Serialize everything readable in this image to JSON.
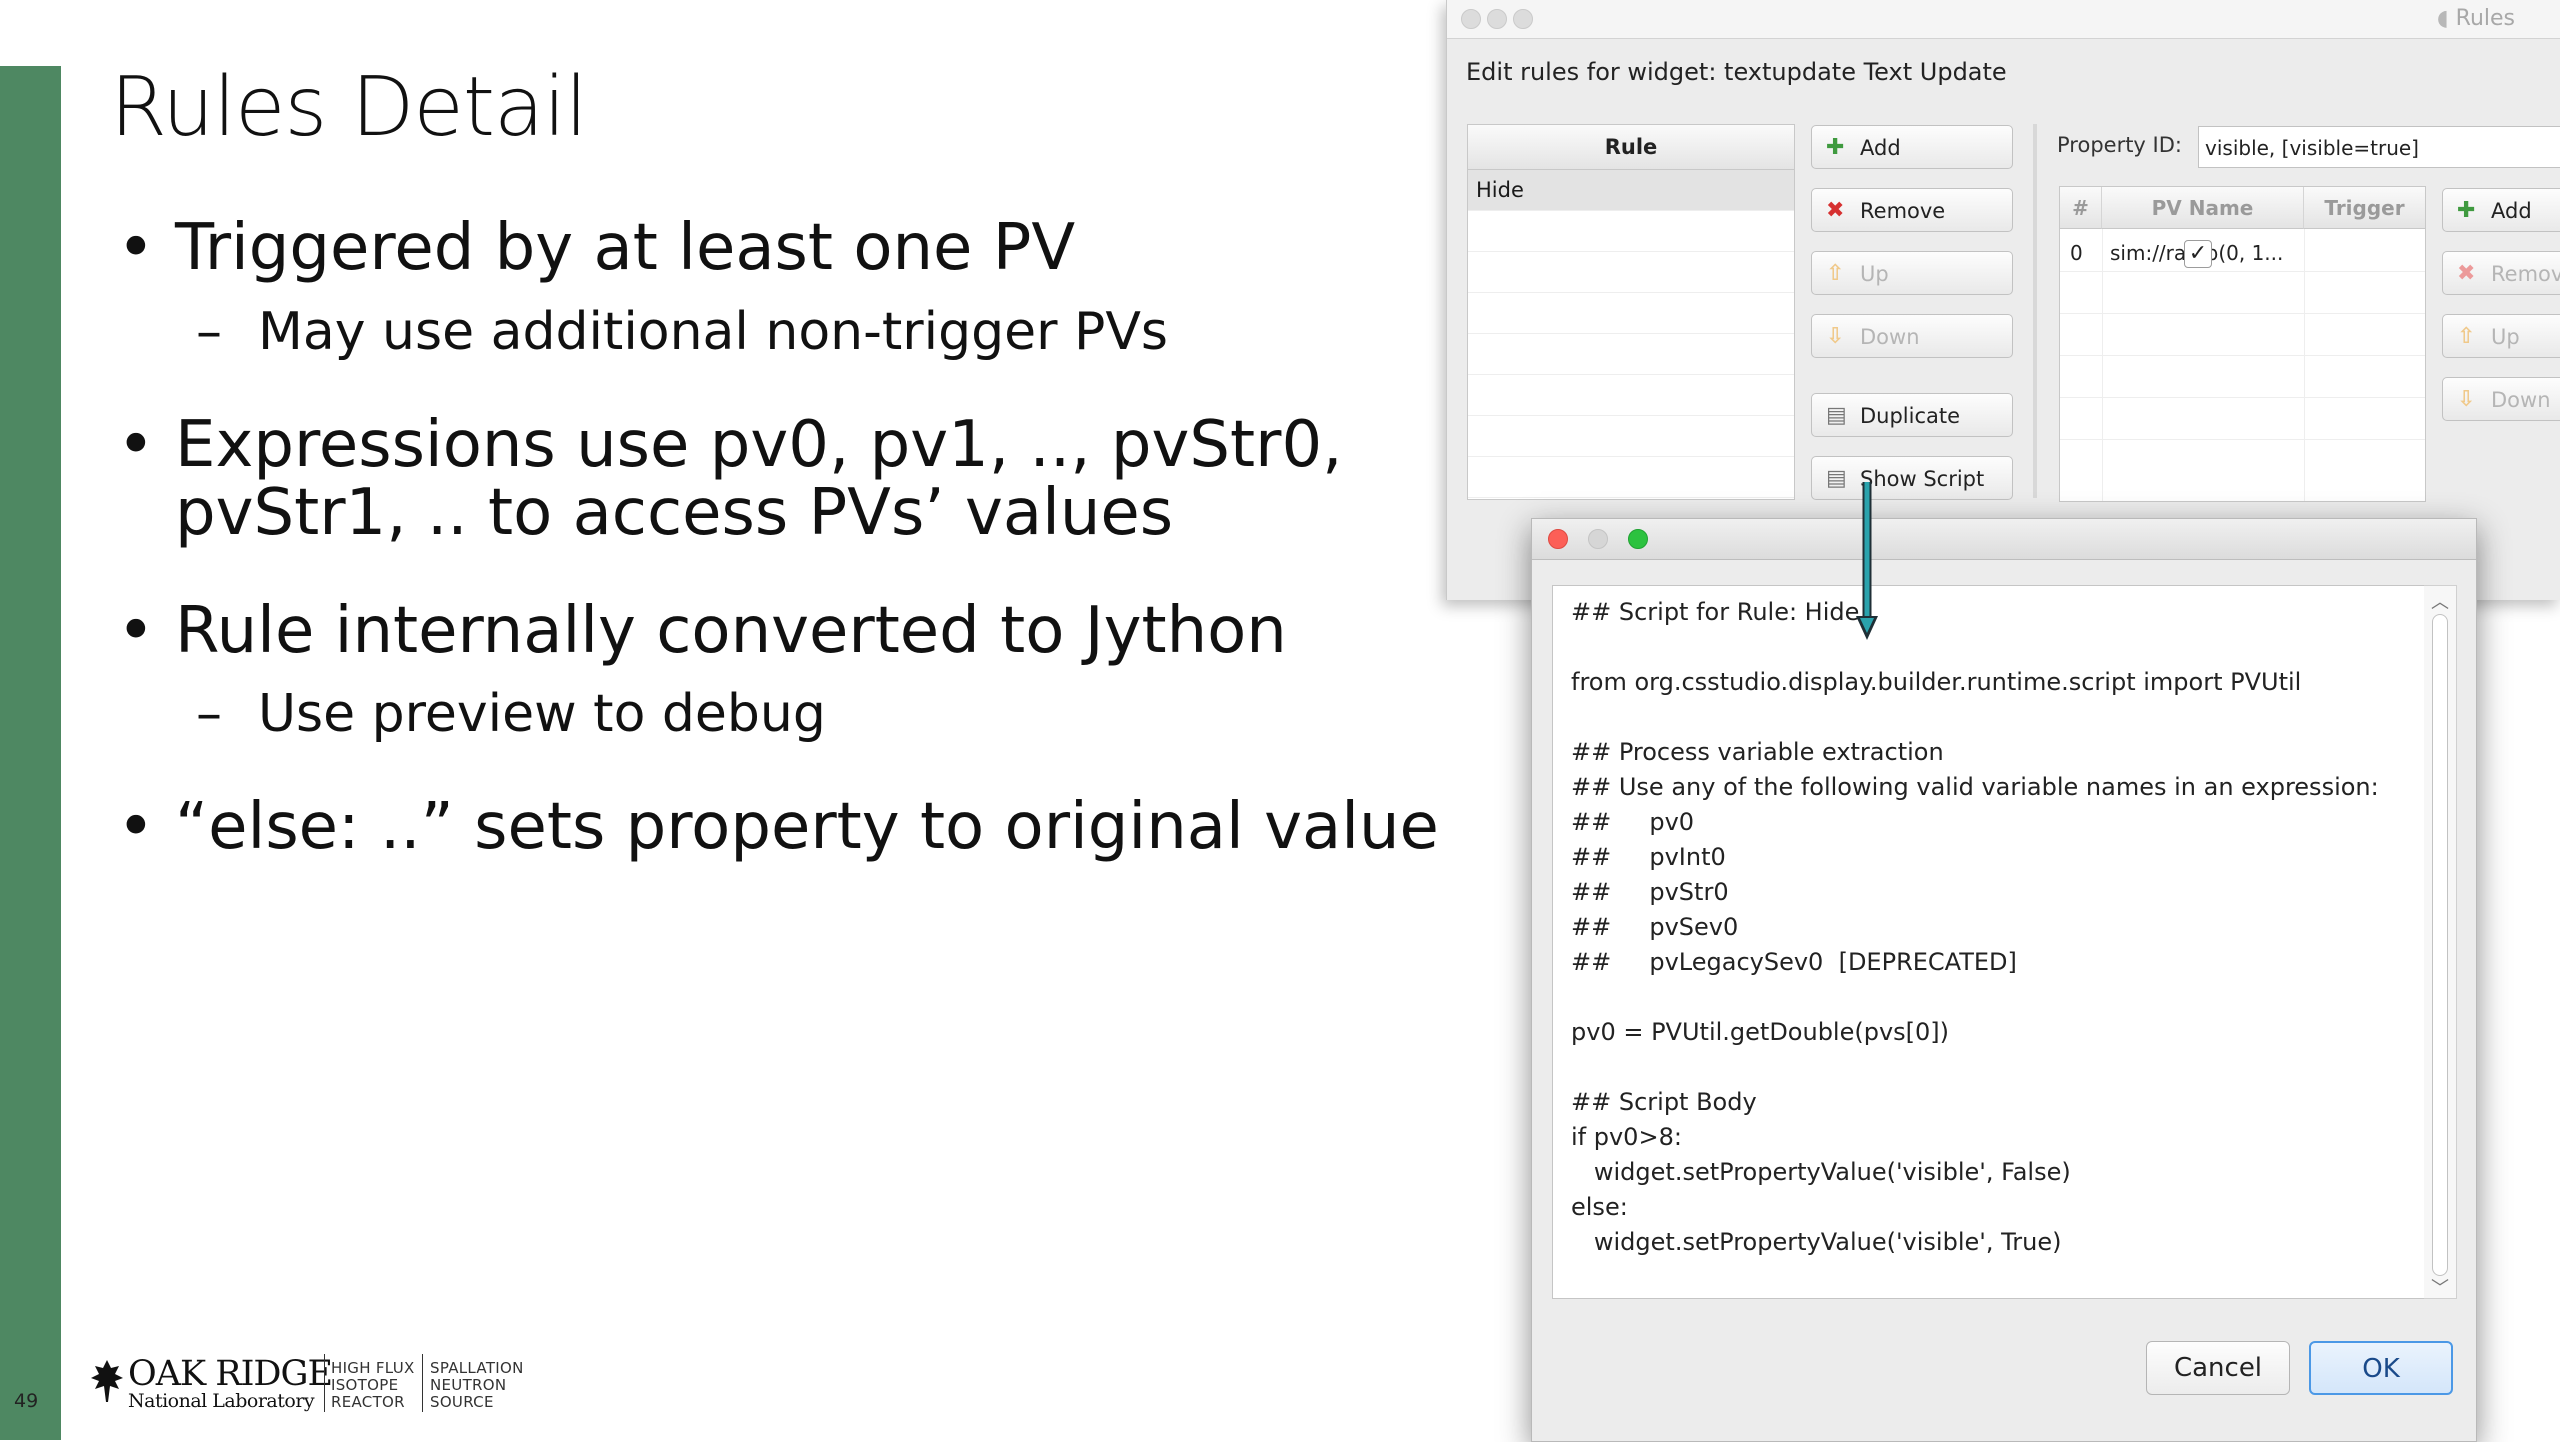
{
  "slide": {
    "number": "49",
    "title": "Rules Detail",
    "bullets": [
      {
        "text": "Triggered by at least one PV",
        "sub": "May use additional non-trigger PVs"
      },
      {
        "text_line1": "Expressions use pv0, pv1, .., pvStr0,",
        "text_line2": "pvStr1, .. to access PVs’ values"
      },
      {
        "text": "Rule internally converted to Jython",
        "sub": "Use preview to debug"
      },
      {
        "text": "“else: ..” sets property to original value"
      }
    ],
    "bullet_symbol": "•",
    "dash_symbol": "–",
    "logo": {
      "main": "OAK RIDGE",
      "sub": "National Laboratory",
      "col1": [
        "HIGH FLUX",
        "ISOTOPE",
        "REACTOR"
      ],
      "col2": [
        "SPALLATION",
        "NEUTRON",
        "SOURCE"
      ],
      "icon": "oak-tree-icon"
    },
    "accent_color": "#4e8862"
  },
  "rules_window": {
    "title": "Rules",
    "label": "Edit rules for widget: textupdate Text Update",
    "rule_column": "Rule",
    "rules": [
      "Hide"
    ],
    "buttons": {
      "add": "Add",
      "remove": "Remove",
      "up": "Up",
      "down": "Down",
      "duplicate": "Duplicate",
      "show_script": "Show Script"
    },
    "property_label": "Property ID:",
    "property_value": "visible, [visible=true]",
    "pv_table": {
      "columns": [
        "#",
        "PV Name",
        "Trigger"
      ],
      "rows": [
        {
          "index": "0",
          "name": "sim://ramp(0, 1...",
          "trigger": "✓"
        }
      ]
    },
    "pv_buttons": {
      "add": "Add",
      "remove": "Remov",
      "up": "Up",
      "down": "Down"
    }
  },
  "script_dialog": {
    "code_lines": [
      "## Script for Rule: Hide",
      "",
      "from org.csstudio.display.builder.runtime.script import PVUtil",
      "",
      "## Process variable extraction",
      "## Use any of the following valid variable names in an expression:",
      "##     pv0",
      "##     pvInt0",
      "##     pvStr0",
      "##     pvSev0",
      "##     pvLegacySev0  [DEPRECATED]",
      "",
      "pv0 = PVUtil.getDouble(pvs[0])",
      "",
      "## Script Body",
      "if pv0>8:",
      "   widget.setPropertyValue('visible', False)",
      "else:",
      "   widget.setPropertyValue('visible', True)"
    ],
    "cancel": "Cancel",
    "ok": "OK"
  }
}
